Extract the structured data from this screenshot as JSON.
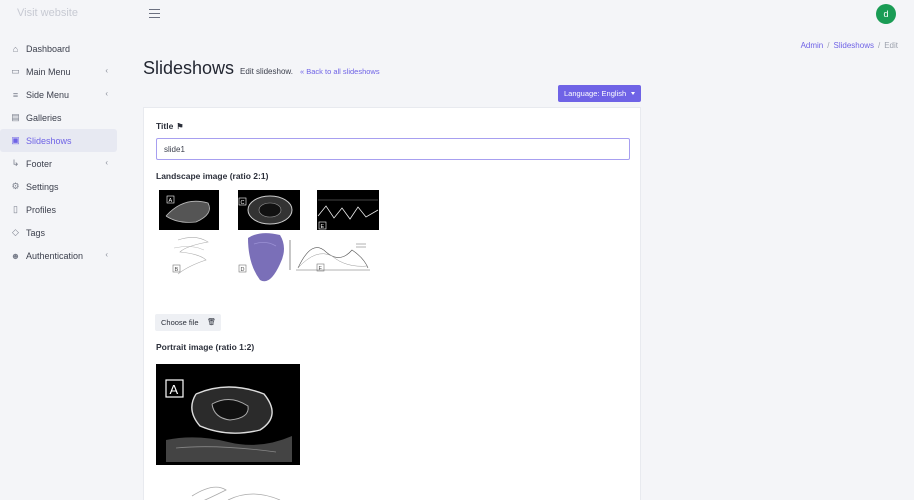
{
  "brand": "Visit website",
  "user_initial": "d",
  "nav": [
    {
      "label": "Dashboard",
      "icon": "home-icon",
      "chevron": false,
      "active": false
    },
    {
      "label": "Main Menu",
      "icon": "window-icon",
      "chevron": true,
      "active": false
    },
    {
      "label": "Side Menu",
      "icon": "list-icon",
      "chevron": true,
      "active": false
    },
    {
      "label": "Galleries",
      "icon": "images-icon",
      "chevron": false,
      "active": false
    },
    {
      "label": "Slideshows",
      "icon": "slides-icon",
      "chevron": false,
      "active": true
    },
    {
      "label": "Footer",
      "icon": "arrow-down-right-icon",
      "chevron": true,
      "active": false
    },
    {
      "label": "Settings",
      "icon": "gear-icon",
      "chevron": false,
      "active": false
    },
    {
      "label": "Profiles",
      "icon": "file-icon",
      "chevron": false,
      "active": false
    },
    {
      "label": "Tags",
      "icon": "tag-icon",
      "chevron": false,
      "active": false
    },
    {
      "label": "Authentication",
      "icon": "users-icon",
      "chevron": true,
      "active": false
    }
  ],
  "breadcrumb": {
    "items": [
      "Admin",
      "Slideshows"
    ],
    "current": "Edit"
  },
  "page": {
    "title": "Slideshows",
    "subtitle": "Edit slideshow.",
    "back_link": "Back to all slideshows"
  },
  "language_button": "Language: English",
  "form": {
    "title_label": "Title",
    "title_value": "slide1",
    "landscape_label": "Landscape image (ratio 2:1)",
    "choose_file": "Choose file",
    "portrait_label": "Portrait image (ratio 1:2)",
    "panel_letters": [
      "A",
      "C",
      "E",
      "B",
      "D",
      "F"
    ]
  },
  "colors": {
    "accent": "#6f63e6",
    "avatar": "#1a9c55"
  }
}
